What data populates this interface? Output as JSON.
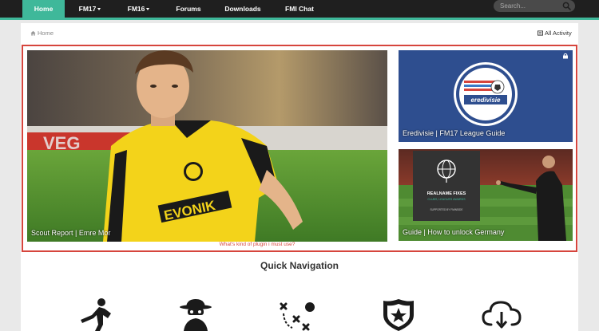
{
  "nav": {
    "items": [
      {
        "label": "Home",
        "active": true,
        "dropdown": false
      },
      {
        "label": "FM17",
        "active": false,
        "dropdown": true
      },
      {
        "label": "FM16",
        "active": false,
        "dropdown": true
      },
      {
        "label": "Forums",
        "active": false,
        "dropdown": false
      },
      {
        "label": "Downloads",
        "active": false,
        "dropdown": false
      },
      {
        "label": "FMI Chat",
        "active": false,
        "dropdown": false
      }
    ],
    "search_placeholder": "Search...",
    "accent_color": "#3fb89a"
  },
  "breadcrumb": {
    "home_label": "Home"
  },
  "activity_label": "All Activity",
  "features": {
    "main": {
      "caption": "Scout Report | Emre Mor",
      "image_text": "EVONIK",
      "ad_text": "VEG"
    },
    "top_right": {
      "caption": "Eredivisie | FM17 League Guide",
      "logo_text": "eredivisie"
    },
    "bottom_right": {
      "caption": "Guide | How to unlock Germany",
      "poster_title": "REALNAME FIXES",
      "poster_subtitle": "CLUBS, LEAGUES AWARDS",
      "poster_footer": "SUPPORTED BY FMINSIDE"
    }
  },
  "plugin_link": "What's kind of plugin i must use?",
  "quick_nav": {
    "title": "Quick Navigation",
    "icons": [
      "player-kick-icon",
      "scout-spy-icon",
      "tactics-board-icon",
      "club-shield-icon",
      "cloud-download-icon"
    ]
  }
}
